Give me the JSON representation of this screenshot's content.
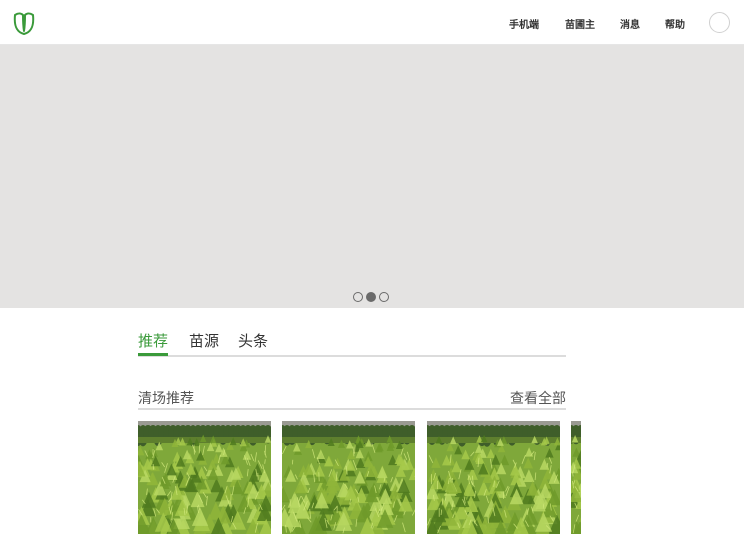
{
  "header": {
    "logo_icon": "leaf-logo-icon",
    "brand_color": "#3a9a3a",
    "nav": [
      {
        "label": "手机端"
      },
      {
        "label": "苗圃主"
      },
      {
        "label": "消息"
      },
      {
        "label": "帮助"
      }
    ],
    "avatar_icon": "user-avatar"
  },
  "banner": {
    "background_color": "#e4e3e2",
    "carousel_total": 3,
    "carousel_active": 2
  },
  "tabs": [
    {
      "label": "推荐",
      "active": true
    },
    {
      "label": "苗源",
      "active": false
    },
    {
      "label": "头条",
      "active": false
    }
  ],
  "section": {
    "title": "清场推荐",
    "view_all": "查看全部"
  },
  "products": [
    {
      "image": "spruce-seedling-field-photo"
    },
    {
      "image": "spruce-seedling-field-photo"
    },
    {
      "image": "spruce-seedling-field-photo"
    },
    {
      "image": "spruce-seedling-field-photo"
    }
  ]
}
